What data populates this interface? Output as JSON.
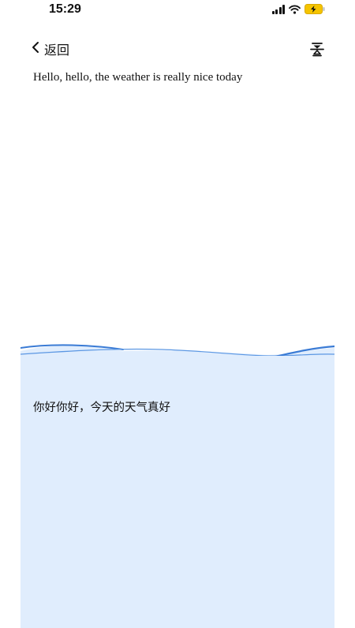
{
  "status_bar": {
    "time": "15:29",
    "icons": [
      "signal-icon",
      "wifi-icon",
      "battery-charging-icon"
    ]
  },
  "header": {
    "back_label": "返回",
    "back_icon": "chevron-left-icon",
    "action_icon": "filter-icon"
  },
  "source_text": "Hello, hello, the weather is really nice today",
  "translation": {
    "text": "你好你好，今天的天气真好"
  },
  "colors": {
    "panel_background": "#e0edfd",
    "wave_stroke": "#3a7bd5",
    "battery_fill": "#f5c400"
  }
}
